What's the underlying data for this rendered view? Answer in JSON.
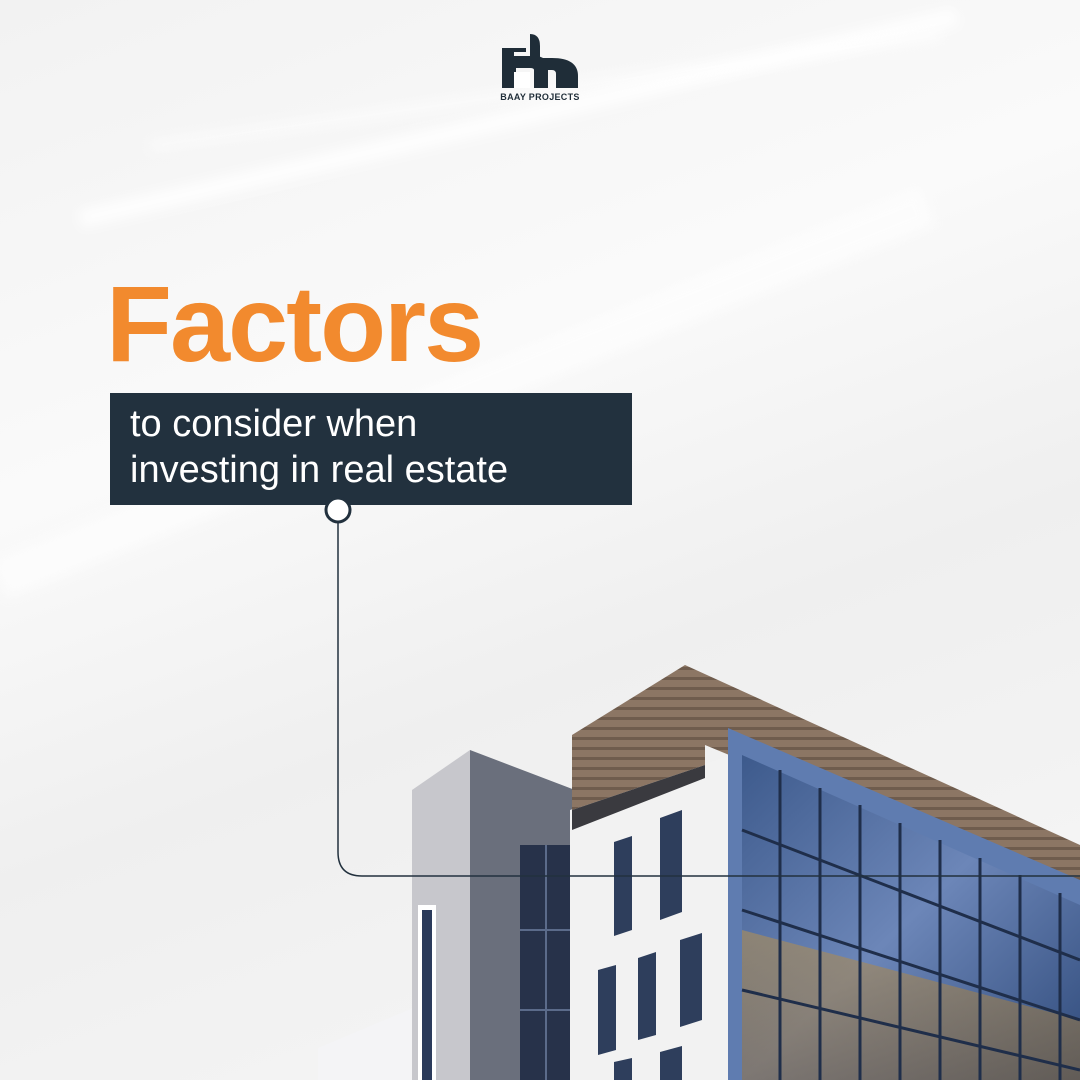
{
  "brand": {
    "name": "BAAY PROJECTS",
    "icon": "baay-logo-icon"
  },
  "headline": "Factors",
  "subtitle": {
    "line1": "to consider when",
    "line2": "investing in real estate"
  },
  "colors": {
    "accent": "#f28a2e",
    "dark": "#22313e",
    "background": "#f5f5f5"
  }
}
